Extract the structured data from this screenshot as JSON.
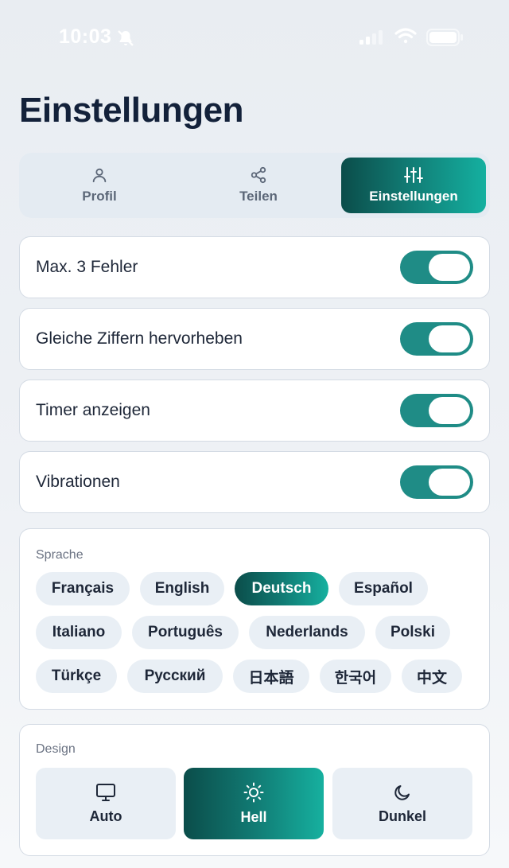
{
  "status_bar": {
    "time": "10:03"
  },
  "page_title": "Einstellungen",
  "tabs": [
    {
      "label": "Profil",
      "icon": "person-icon",
      "active": false
    },
    {
      "label": "Teilen",
      "icon": "share-icon",
      "active": false
    },
    {
      "label": "Einstellungen",
      "icon": "sliders-icon",
      "active": true
    }
  ],
  "toggles": [
    {
      "label": "Max. 3 Fehler",
      "on": true
    },
    {
      "label": "Gleiche Ziffern hervorheben",
      "on": true
    },
    {
      "label": "Timer anzeigen",
      "on": true
    },
    {
      "label": "Vibrationen",
      "on": true
    }
  ],
  "language": {
    "label": "Sprache",
    "options": [
      "Français",
      "English",
      "Deutsch",
      "Español",
      "Italiano",
      "Português",
      "Nederlands",
      "Polski",
      "Türkçe",
      "Русский",
      "日本語",
      "한국어",
      "中文"
    ],
    "selected": "Deutsch"
  },
  "design": {
    "label": "Design",
    "options": [
      {
        "label": "Auto",
        "icon": "monitor-icon"
      },
      {
        "label": "Hell",
        "icon": "sun-icon"
      },
      {
        "label": "Dunkel",
        "icon": "moon-icon"
      }
    ],
    "selected": "Hell"
  },
  "colors": {
    "accent": "#1f8c86",
    "accent_dark": "#0b4d4a",
    "accent_light": "#14b0a0"
  }
}
